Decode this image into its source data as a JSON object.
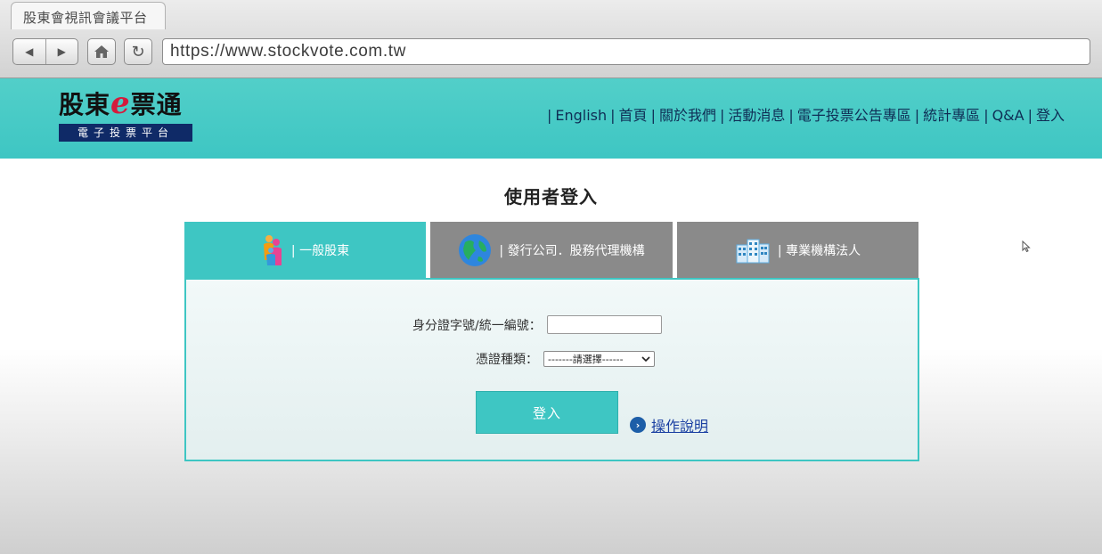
{
  "browser": {
    "tab_title": "股東會視訊會議平台",
    "url": "https://www.stockvote.com.tw"
  },
  "site": {
    "logo_main_1": "股東",
    "logo_e": "e",
    "logo_main_2": "票通",
    "logo_sub": "電子投票平台",
    "nav": [
      "English",
      "首頁",
      "關於我們",
      "活動消息",
      "電子投票公告專區",
      "統計專區",
      "Q&A",
      "登入"
    ]
  },
  "page": {
    "title": "使用者登入",
    "tabs": [
      {
        "label": "| 一般股東",
        "icon": "people-icon"
      },
      {
        "label": "| 發行公司．股務代理機構",
        "icon": "globe-icon"
      },
      {
        "label": "| 專業機構法人",
        "icon": "buildings-icon"
      }
    ],
    "form": {
      "id_label": "身分證字號/統一編號：",
      "id_value": "",
      "cert_label": "憑證種類：",
      "cert_selected": "-------請選擇------",
      "login_label": "登入",
      "help_label": "操作說明"
    }
  },
  "colors": {
    "accent": "#3ec6c3",
    "tab_inactive": "#8a8a8a",
    "nav_text": "#0f2e55",
    "logo_sub_bg": "#0f2a67"
  }
}
